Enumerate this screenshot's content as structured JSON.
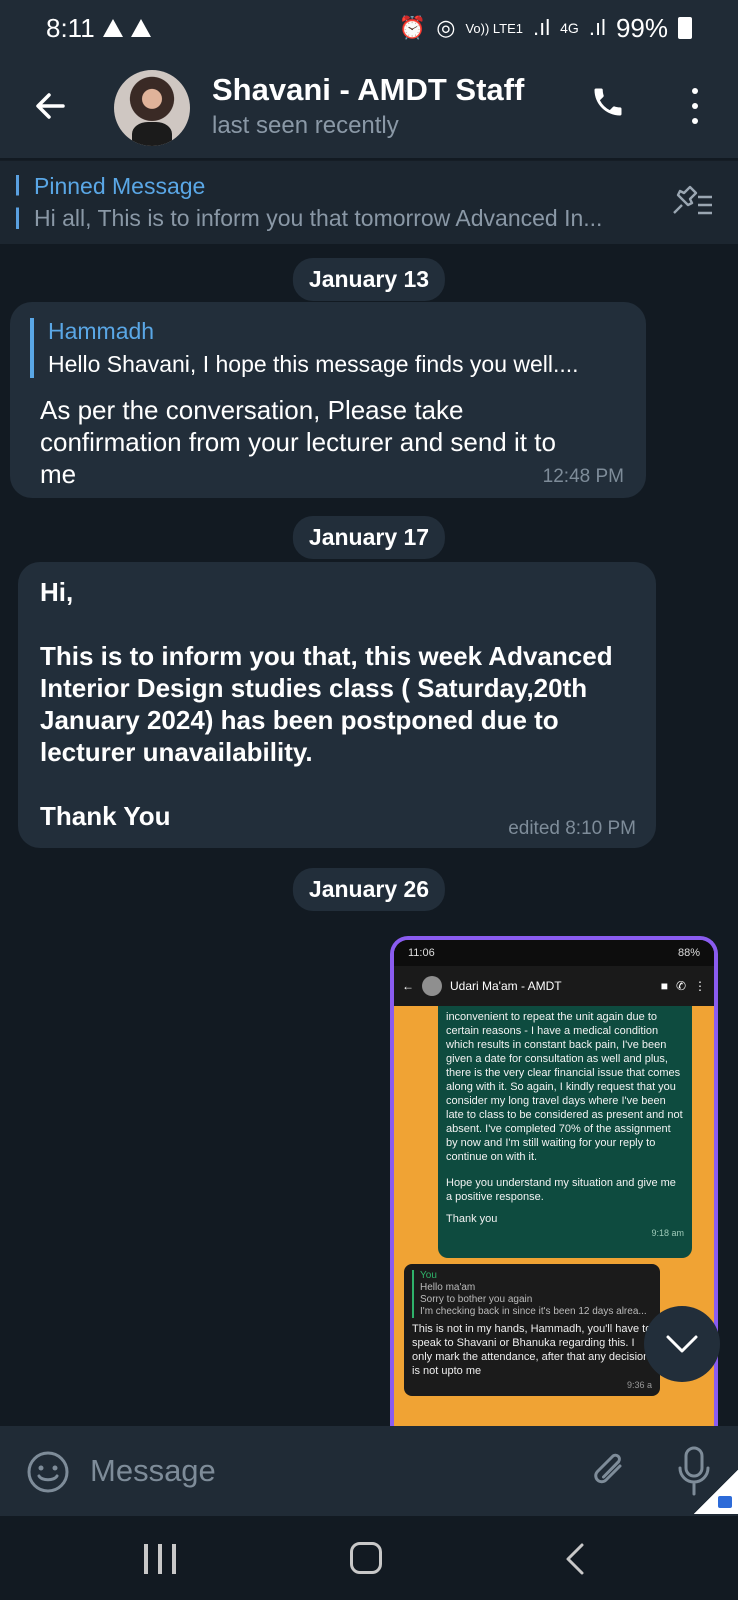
{
  "status_bar": {
    "time": "8:11",
    "network_label": "Vo)) LTE1",
    "network_type": "4G",
    "battery": "99%"
  },
  "header": {
    "title": "Shavani - AMDT Staff",
    "subtitle": "last seen recently"
  },
  "pinned": {
    "label": "Pinned Message",
    "text": "Hi all,  This is to inform you that tomorrow Advanced In..."
  },
  "messages": {
    "date1": "January 13",
    "reply_name": "Hammadh",
    "reply_text": "Hello Shavani,  I hope this message finds you well....",
    "msg1_line1": "As per the conversation, Please take",
    "msg1_line2": "confirmation from your lecturer and send it to",
    "msg1_line3": "me",
    "msg1_time": "12:48 PM",
    "date2": "January 17",
    "msg2_line1": "Hi,",
    "msg2_line2": "This is to inform you that, this week Advanced",
    "msg2_line3": "Interior Design studies class ( Saturday,20th",
    "msg2_line4": "January 2024) has been postponed due to",
    "msg2_line5": "lecturer unavailability.",
    "msg2_line6": "Thank You",
    "msg2_time": "edited 8:10 PM",
    "date3": "January 26"
  },
  "screenshot": {
    "time": "11:06",
    "battery": "88%",
    "contact": "Udari Ma'am - AMDT",
    "green_text": "inconvenient to repeat the unit again due to certain reasons - I have a medical condition which results in constant back pain, I've been given a date for consultation as well and plus, there is the very clear financial issue that comes along with it. So again, I kindly request that you consider my long travel days where I've been late to class to be considered as present and not absent. I've completed 70% of the assignment by now and I'm still waiting for your reply to continue on with it.",
    "green_text2": "Hope you understand my situation and give me a positive response.",
    "green_thanks": "Thank you",
    "green_time": "9:18 am",
    "quote_you": "You",
    "quote_line1": "Hello ma'am",
    "quote_line2": "Sorry to bother you again",
    "quote_line3": "I'm checking back in since it's been 12 days alrea...",
    "reply_text": "This is not in my hands, Hammadh, you'll have to speak to Shavani or Bhanuka regarding this. I only mark the attendance, after that any decision is not upto me",
    "reply_time": "9:36 a"
  },
  "composer": {
    "placeholder": "Message"
  },
  "colors": {
    "background": "#121a22",
    "header": "#202b36",
    "bubble": "#222e3a",
    "accent": "#5aa7e6"
  }
}
